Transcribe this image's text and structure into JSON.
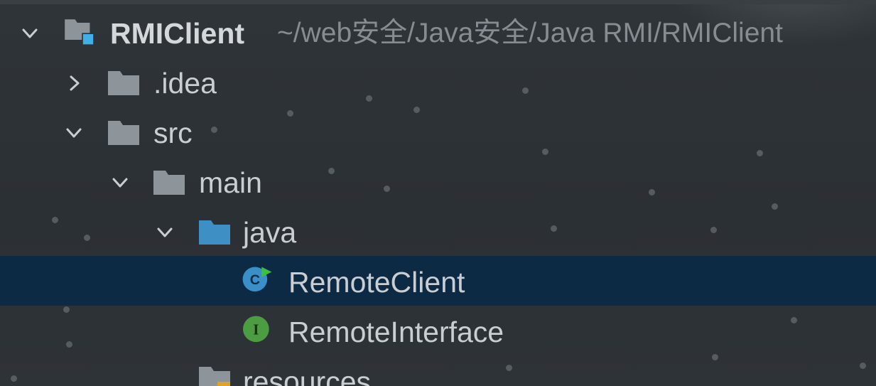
{
  "project": {
    "name": "RMIClient",
    "path": "~/web安全/Java安全/Java RMI/RMIClient"
  },
  "items": [
    {
      "label": ".idea",
      "icon": "folder-icon"
    },
    {
      "label": "src",
      "icon": "folder-icon"
    },
    {
      "label": "main",
      "icon": "folder-icon"
    },
    {
      "label": "java",
      "icon": "source-folder-icon"
    },
    {
      "label": "RemoteClient",
      "icon": "class-icon",
      "selected": true
    },
    {
      "label": "RemoteInterface",
      "icon": "interface-icon"
    },
    {
      "label": "resources",
      "icon": "resources-folder-icon"
    }
  ],
  "colors": {
    "background": "#2d3236",
    "selection": "#0d2a44",
    "folder": "#8d959b",
    "source_folder": "#3d8fc4",
    "class": "#3b8fc8",
    "interface": "#4c9d42",
    "run_marker": "#3fbf3f",
    "path_text": "#868c91"
  }
}
